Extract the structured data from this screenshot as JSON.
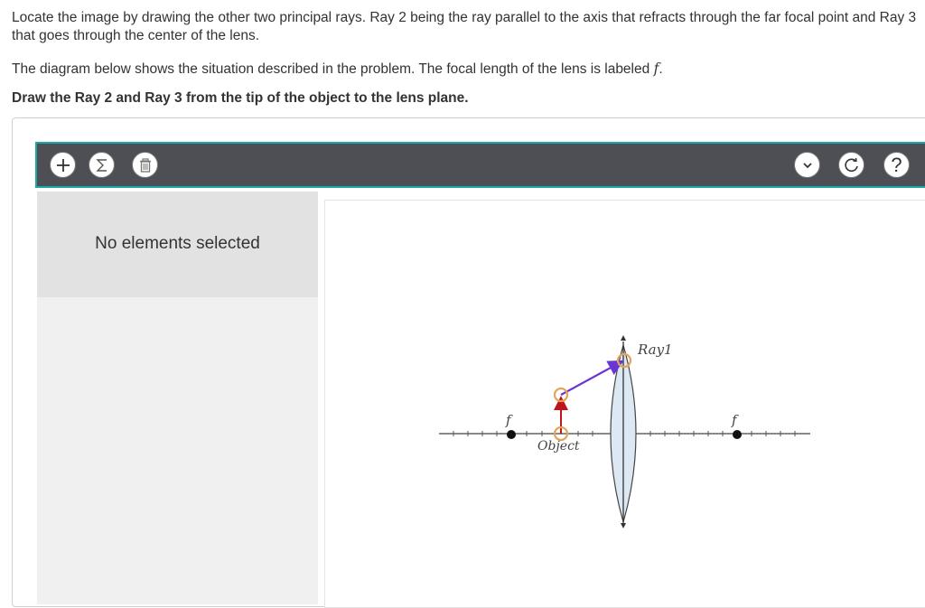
{
  "question": {
    "instructions": "Locate the image by drawing the other two principal rays. Ray 2 being the ray parallel to the axis that refracts through the far focal point and Ray 3 that goes through the center of the lens.",
    "diagram_note_prefix": "The diagram below shows the situation described in the problem. The focal length of the lens is labeled",
    "focal_symbol": "f",
    "diagram_note_suffix": ".",
    "task": "Draw the Ray 2 and Ray 3 from the tip of the object to the lens plane."
  },
  "toolbar": {
    "add_icon": "plus-icon",
    "sum_icon": "sigma-icon",
    "delete_icon": "trash-icon",
    "expand_icon": "chevron-down-icon",
    "reset_icon": "refresh-icon",
    "help_label": "?",
    "background": "#4d4f55",
    "border_accent": "#1aa7a8"
  },
  "side_panel": {
    "status": "No elements selected"
  },
  "diagram": {
    "focal_left_label": "f",
    "focal_right_label": "f",
    "object_label": "Object",
    "ray_label": "Ray1",
    "colors": {
      "object_arrow": "#c0141c",
      "ray1": "#6a35d4",
      "handle": "#e6a35a",
      "lens_fill": "#dce9f4",
      "axis": "#444444"
    }
  }
}
